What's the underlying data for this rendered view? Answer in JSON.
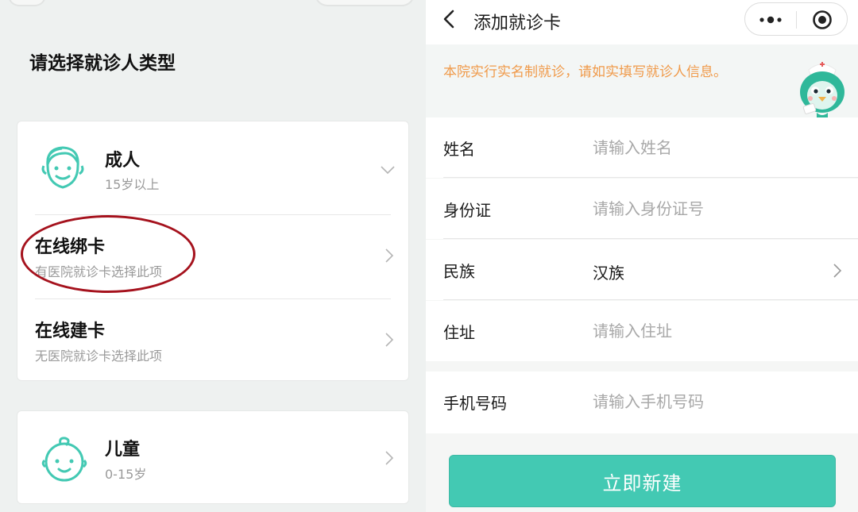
{
  "left": {
    "heading": "请选择就诊人类型",
    "adult": {
      "title": "成人",
      "subtitle": "15岁以上",
      "icon": "adult-face-icon"
    },
    "options": [
      {
        "title": "在线绑卡",
        "subtitle": "有医院就诊卡选择此项"
      },
      {
        "title": "在线建卡",
        "subtitle": "无医院就诊卡选择此项"
      }
    ],
    "child": {
      "title": "儿童",
      "subtitle": "0-15岁",
      "icon": "baby-face-icon"
    }
  },
  "right": {
    "nav": {
      "title": "添加就诊卡",
      "back_icon": "back-arrow-icon",
      "more_icon": "more-dots-icon",
      "close_icon": "target-circle-icon"
    },
    "notice": "本院实行实名制就诊，请如实填写就诊人信息。",
    "form": {
      "name": {
        "label": "姓名",
        "placeholder": "请输入姓名"
      },
      "id": {
        "label": "身份证",
        "placeholder": "请输入身份证号"
      },
      "ethnicity": {
        "label": "民族",
        "value": "汉族"
      },
      "address": {
        "label": "住址",
        "placeholder": "请输入住址"
      },
      "phone": {
        "label": "手机号码",
        "placeholder": "请输入手机号码"
      }
    },
    "submit_label": "立即新建"
  },
  "colors": {
    "accent": "#43c9b3",
    "notice": "#f09a4a",
    "highlight": "#a5121d"
  }
}
